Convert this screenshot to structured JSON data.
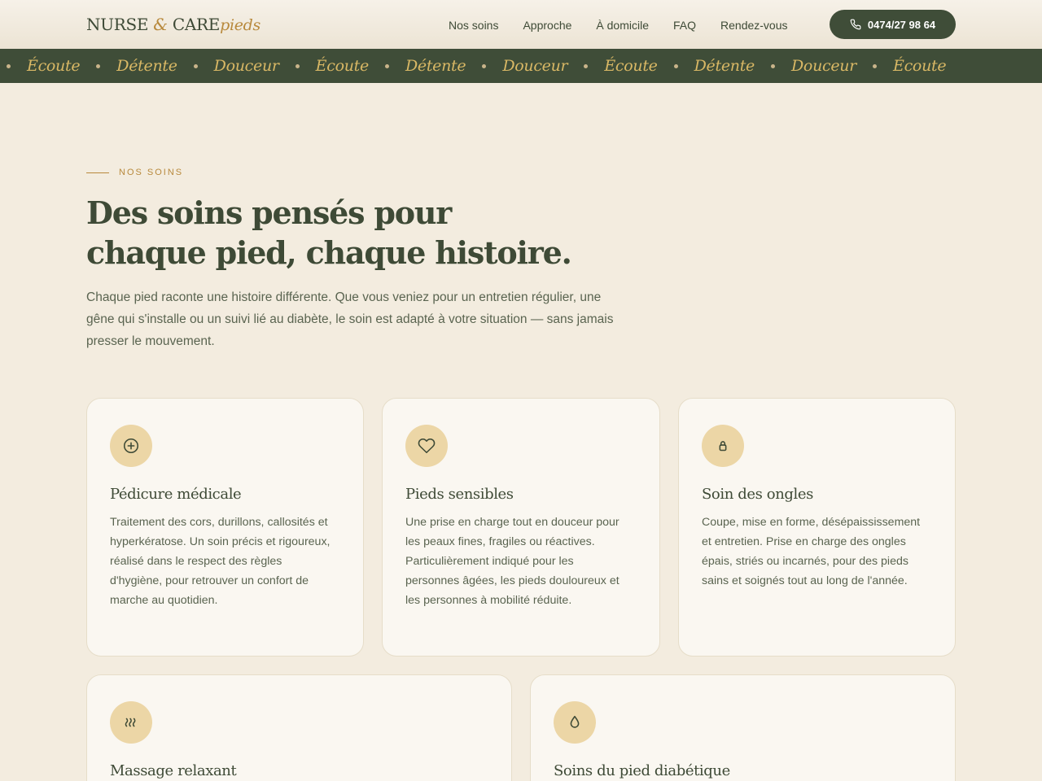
{
  "header": {
    "logo": {
      "part1": "NURSE",
      "amp": "&",
      "part2": "CARE",
      "script": "pieds"
    },
    "nav": [
      {
        "label": "Nos soins"
      },
      {
        "label": "Approche"
      },
      {
        "label": "À domicile"
      },
      {
        "label": "FAQ"
      },
      {
        "label": "Rendez-vous"
      }
    ],
    "phone": "0474/27 98 64"
  },
  "band": {
    "words": [
      "Écoute",
      "Détente",
      "Douceur",
      "Écoute",
      "Détente",
      "Douceur",
      "Écoute",
      "Détente",
      "Douceur",
      "Écoute"
    ]
  },
  "section": {
    "eyebrow": "NOS SOINS",
    "title_line1": "Des soins pensés pour",
    "title_line2": "chaque pied, chaque histoire.",
    "lead": "Chaque pied raconte une histoire différente. Que vous veniez pour un entretien régulier, une gêne qui s'installe ou un suivi lié au diabète, le soin est adapté à votre situation — sans jamais presser le mouvement."
  },
  "cards": [
    {
      "icon": "plus-circle-icon",
      "title": "Pédicure médicale",
      "text": "Traitement des cors, durillons, callosités et hyperkératose. Un soin précis et rigoureux, réalisé dans le respect des règles d'hygiène, pour retrouver un confort de marche au quotidien."
    },
    {
      "icon": "heart-icon",
      "title": "Pieds sensibles",
      "text": "Une prise en charge tout en douceur pour les peaux fines, fragiles ou réactives. Particulièrement indiqué pour les personnes âgées, les pieds douloureux et les personnes à mobilité réduite."
    },
    {
      "icon": "lock-icon",
      "title": "Soin des ongles",
      "text": "Coupe, mise en forme, désépaississement et entretien. Prise en charge des ongles épais, striés ou incarnés, pour des pieds sains et soignés tout au long de l'année."
    },
    {
      "icon": "waves-icon",
      "title": "Massage relaxant",
      "text": ""
    },
    {
      "icon": "drop-icon",
      "title": "Soins du pied diabétique",
      "text": ""
    }
  ],
  "colors": {
    "background": "#f3ecdf",
    "primary": "#3f4d38",
    "accent": "#b8893c",
    "band_text": "#d9b865",
    "icon_bg": "#ecd6a6"
  }
}
